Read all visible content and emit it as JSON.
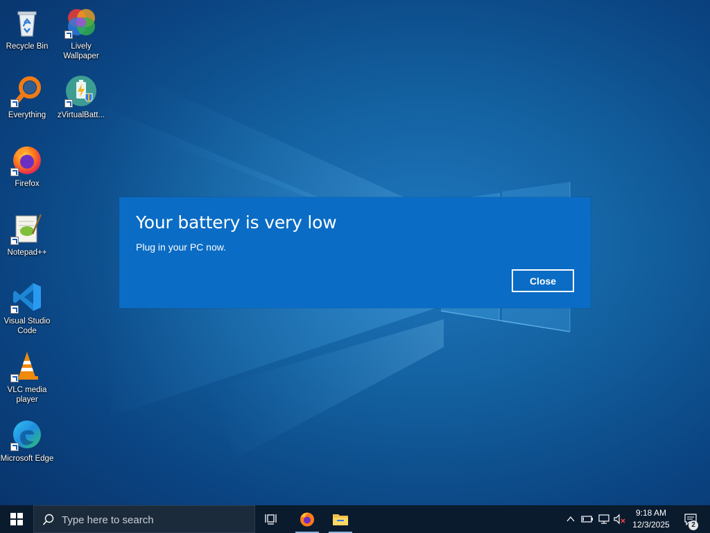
{
  "desktop": {
    "icons": [
      {
        "label": "Recycle Bin"
      },
      {
        "label": "Lively Wallpaper"
      },
      {
        "label": "Everything"
      },
      {
        "label": "zVirtualBatt..."
      },
      {
        "label": "Firefox"
      },
      {
        "label": "Notepad++"
      },
      {
        "label": "Visual Studio Code"
      },
      {
        "label": "VLC media player"
      },
      {
        "label": "Microsoft Edge"
      }
    ]
  },
  "dialog": {
    "title": "Your battery is very low",
    "message": "Plug in your PC now.",
    "close_label": "Close",
    "bg_color": "#0a6cc4"
  },
  "taskbar": {
    "search_placeholder": "Type here to search",
    "clock_time": "9:18 AM",
    "clock_date": "12/3/2025",
    "notification_count": "2",
    "pinned": [
      "task-view-icon",
      "firefox-icon",
      "file-explorer-icon"
    ],
    "tray": [
      "chevron-up-icon",
      "battery-icon",
      "network-icon",
      "volume-muted-icon",
      "notification-icon"
    ]
  }
}
